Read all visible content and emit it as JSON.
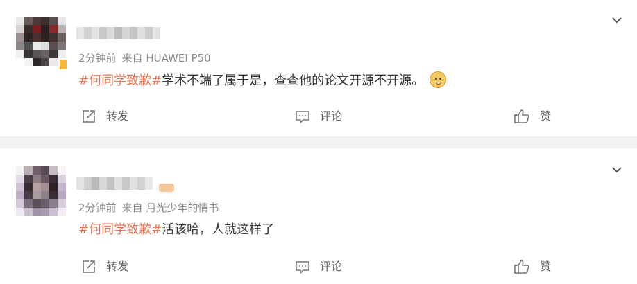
{
  "posts": [
    {
      "time": "2分钟前",
      "source_prefix": "来自",
      "source": "HUAWEI P50",
      "hashtag": "#何同学致歉#",
      "text": "学术不端了属于是，查查他的论文开源不开源。",
      "emoji": "doge-emoji",
      "actions": {
        "repost": "转发",
        "comment": "评论",
        "like": "赞"
      }
    },
    {
      "time": "2分钟前",
      "source_prefix": "来自",
      "source": "月光少年的情书",
      "hashtag": "#何同学致歉#",
      "text": "活该哈，人就这样了",
      "actions": {
        "repost": "转发",
        "comment": "评论",
        "like": "赞"
      }
    }
  ],
  "icons": {
    "more": "chevron-down-icon",
    "repost": "share-arrow-icon",
    "comment": "comment-bubble-icon",
    "like": "thumbs-up-icon"
  },
  "colors": {
    "hashtag": "#eb7350",
    "meta": "#8a8a8a",
    "text": "#333333",
    "action": "#666666",
    "separator": "#f2f2f4",
    "vip_badge": "#f5b83a"
  }
}
